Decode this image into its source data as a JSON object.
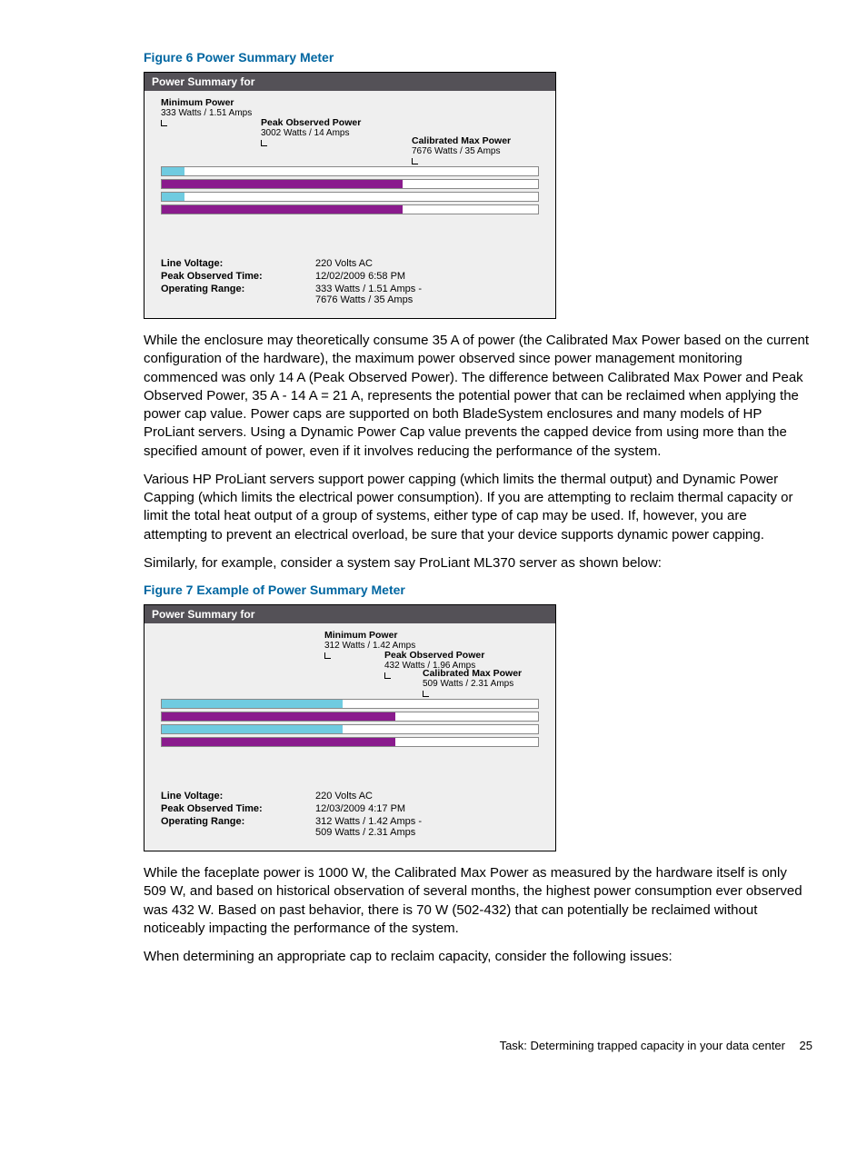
{
  "figure6": {
    "caption": "Figure 6 Power Summary Meter",
    "panel_title": "Power Summary for",
    "markers": {
      "min": {
        "title": "Minimum Power",
        "sub": "333 Watts / 1.51 Amps"
      },
      "peak": {
        "title": "Peak Observed Power",
        "sub": "3002 Watts / 14 Amps"
      },
      "max": {
        "title": "Calibrated Max Power",
        "sub": "7676 Watts / 35 Amps"
      }
    },
    "details": {
      "line_voltage_label": "Line Voltage:",
      "line_voltage_value": "220 Volts AC",
      "peak_time_label": "Peak Observed Time:",
      "peak_time_value": "12/02/2009 6:58 PM",
      "range_label": "Operating Range:",
      "range_value_1": "333 Watts / 1.51 Amps -",
      "range_value_2": "7676 Watts / 35 Amps"
    }
  },
  "para1": "While the enclosure may theoretically consume 35 A of power (the Calibrated Max Power based on the current configuration of the hardware), the maximum power observed since power management monitoring commenced was only 14 A (Peak Observed Power). The difference between Calibrated Max Power and Peak Observed Power, 35 A - 14 A = 21 A, represents the potential power that can be reclaimed when applying the power cap value. Power caps are supported on both BladeSystem enclosures and many models of HP ProLiant servers. Using a Dynamic Power Cap value prevents the capped device from using more than the specified amount of power, even if it involves reducing the performance of the system.",
  "para2": "Various HP ProLiant servers support power capping (which limits the thermal output) and Dynamic Power Capping (which limits the electrical power consumption). If you are attempting to reclaim thermal capacity or limit the total heat output of a group of systems, either type of cap may be used. If, however, you are attempting to prevent an electrical overload, be sure that your device supports dynamic power capping.",
  "para3": "Similarly, for example, consider a system say ProLiant ML370 server as shown below:",
  "figure7": {
    "caption": "Figure 7 Example of Power Summary Meter",
    "panel_title": "Power Summary for",
    "markers": {
      "min": {
        "title": "Minimum Power",
        "sub": "312 Watts / 1.42 Amps"
      },
      "peak": {
        "title": "Peak Observed Power",
        "sub": "432 Watts / 1.96 Amps"
      },
      "max": {
        "title": "Calibrated Max Power",
        "sub": "509 Watts / 2.31 Amps"
      }
    },
    "details": {
      "line_voltage_label": "Line Voltage:",
      "line_voltage_value": "220 Volts AC",
      "peak_time_label": "Peak Observed Time:",
      "peak_time_value": "12/03/2009 4:17 PM",
      "range_label": "Operating Range:",
      "range_value_1": "312 Watts / 1.42 Amps -",
      "range_value_2": "509 Watts / 2.31 Amps"
    }
  },
  "para4": "While the faceplate power is 1000 W, the Calibrated Max Power as measured by the hardware itself is only 509 W, and based on historical observation of several months, the highest power consumption ever observed was 432 W. Based on past behavior, there is 70 W (502-432) that can potentially be reclaimed without noticeably impacting the performance of the system.",
  "para5": "When determining an appropriate cap to reclaim capacity, consider the following issues:",
  "footer": {
    "text": "Task: Determining trapped capacity in your data center",
    "page": "25"
  }
}
